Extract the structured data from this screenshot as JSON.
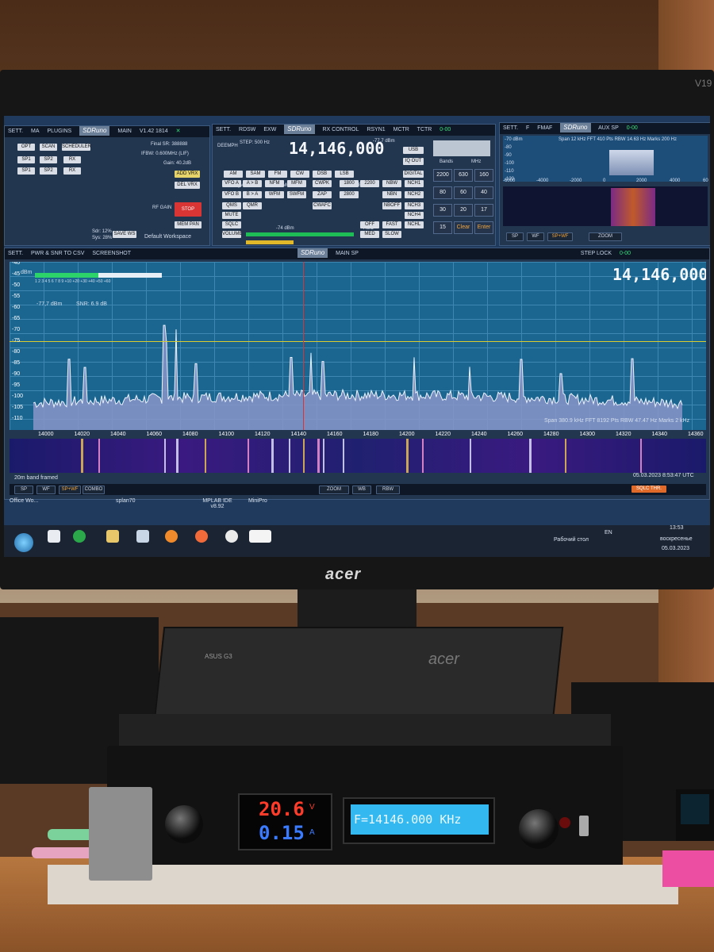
{
  "monitor": {
    "brand": "acer",
    "model": "V19",
    "stand_brand": "acer"
  },
  "panel_win": {
    "menu": [
      "SETT.",
      "MA",
      "PLUGINS"
    ],
    "logo": "SDRuno",
    "tag": "MAIN",
    "version": "V1.42 1814",
    "buttons": [
      "OPT",
      "SCAN",
      "SCHEDULER",
      "SP1",
      "SP2",
      "RX",
      "SP1",
      "SP2",
      "RX",
      "STOP",
      "MEM PAN",
      "ADD VRX",
      "DEL VRX",
      "SAVE WS"
    ],
    "final_sr": "Final SR: 388888",
    "ifbw": "IFBW: 0.600MHz (LIF)",
    "gain": "Gain: 40.2dB",
    "rf_gain": "RF GAIN",
    "sdr": "Sdr: 12%",
    "sys": "Sys: 28%",
    "workspace": "Default Workspace"
  },
  "rx_control": {
    "menu": [
      "SETT.",
      "RDSW",
      "EXW"
    ],
    "logo": "SDRuno",
    "tag": "RX CONTROL",
    "right_menu": [
      "RSYN1",
      "MCTR",
      "TCTR"
    ],
    "deemph": "DEEMPH",
    "step": "STEP: 500 Hz",
    "frequency": "14,146,000",
    "level": "-77,7 dBm",
    "modes": [
      "AM",
      "SAM",
      "FM",
      "CW",
      "DSB",
      "LSB",
      "USB",
      "DIGITAL"
    ],
    "vfo_label": "VFO - QM",
    "fm_mode": "FM MODE",
    "cw_op": "CW OP",
    "filter": "FILTER",
    "nb": "NB",
    "notch": "NOTCH",
    "row_buttons": [
      "VFO A",
      "A > B",
      "NFM",
      "MFM",
      "CWPK",
      "1800",
      "2200",
      "NBW",
      "NCH1",
      "VFO B",
      "B > A",
      "WFM",
      "SWFM",
      "ZAP",
      "2800",
      "NBN",
      "NCH2",
      "QMS",
      "QMR",
      "CWAFC",
      "NBOFF",
      "NCH3",
      "MUTE",
      "NCH4",
      "SQLC",
      "OFF",
      "FAST",
      "VOLUME",
      "MED",
      "SLOW",
      "NCHL"
    ],
    "agc": "AGC",
    "sq_level": "-74 dBm",
    "iq_out": "IQ OUT",
    "keypad": [
      "2200",
      "630",
      "160",
      "80",
      "60",
      "40",
      "30",
      "20",
      "17",
      "15",
      "Clear",
      "Enter"
    ],
    "keypad_top": [
      "Bands",
      "MHz"
    ],
    "clock": "0-00"
  },
  "aux_sp": {
    "menu": [
      "SETT.",
      "F",
      "FMAF"
    ],
    "logo": "SDRuno",
    "tag": "AUX SP",
    "clock": "0-00",
    "info": "Span 12 kHz   FFT 410 Pts   RBW 14.63 Hz   Marks 200 Hz",
    "dbm_unit": "-70 dBm",
    "y_labels": [
      "-80",
      "-90",
      "-100",
      "-110",
      "-120"
    ],
    "x_labels": [
      "-6000",
      "-4000",
      "-2000",
      "0",
      "2000",
      "4000",
      "60"
    ],
    "buttons": [
      "SP",
      "WF",
      "SP+WF",
      "ZOOM"
    ]
  },
  "main_sp": {
    "menu": [
      "SETT.",
      "PWR & SNR TO CSV",
      "SCREENSHOT"
    ],
    "logo": "SDRuno",
    "tag": "MAIN SP",
    "step_lock": "STEP LOCK",
    "clock": "0-00",
    "frequency": "14,146,000",
    "dbm_unit": "dBm",
    "smeter_scale": "1  2  3  4  5  6  7  8  9  +10  +20  +30  +40  +50  +60",
    "level": "-77,7 dBm",
    "snr": "SNR: 6.9 dB",
    "y_labels": [
      "-40",
      "-45",
      "-50",
      "-55",
      "-60",
      "-65",
      "-70",
      "-75",
      "-80",
      "-85",
      "-90",
      "-95",
      "-100",
      "-105",
      "-110"
    ],
    "x_labels": [
      "14000",
      "14020",
      "14040",
      "14060",
      "14080",
      "14100",
      "14120",
      "14140",
      "14160",
      "14180",
      "14200",
      "14220",
      "14240",
      "14260",
      "14280",
      "14300",
      "14320",
      "14340",
      "14360"
    ],
    "span_info": "Span 380.9 kHz   FFT 8192 Pts   RBW 47.47 Hz   Marks 2 kHz",
    "band_label": "20m band framed",
    "timestamp": "05.03.2023  8:53:47 UTC",
    "bottom_buttons": [
      "SP",
      "WF",
      "SP+WF",
      "COMBO",
      "ZOOM",
      "WB",
      "RBW",
      "SQLC THR."
    ]
  },
  "desktop": {
    "icons": [
      "Office Wo...",
      "splan70",
      "MPLAB IDE v8.92",
      "MiniPro"
    ],
    "desktop_label": "Рабочий стол",
    "lang": "EN",
    "time": "13:53",
    "day": "воскресенье",
    "date": "05.03.2023"
  },
  "device": {
    "volts": "20.6",
    "volts_unit": "V",
    "amps": "0.15",
    "amps_unit": "A",
    "lcd_text": "F=14146.000 KHz",
    "tray_label": "ASUS G3"
  },
  "colors": {
    "spectrum_bg": "#1a6691",
    "lcd_bg": "#33b8ef",
    "volt_red": "#ff3b2a",
    "amp_blue": "#3b7bff",
    "accent_green": "#39e07a"
  }
}
